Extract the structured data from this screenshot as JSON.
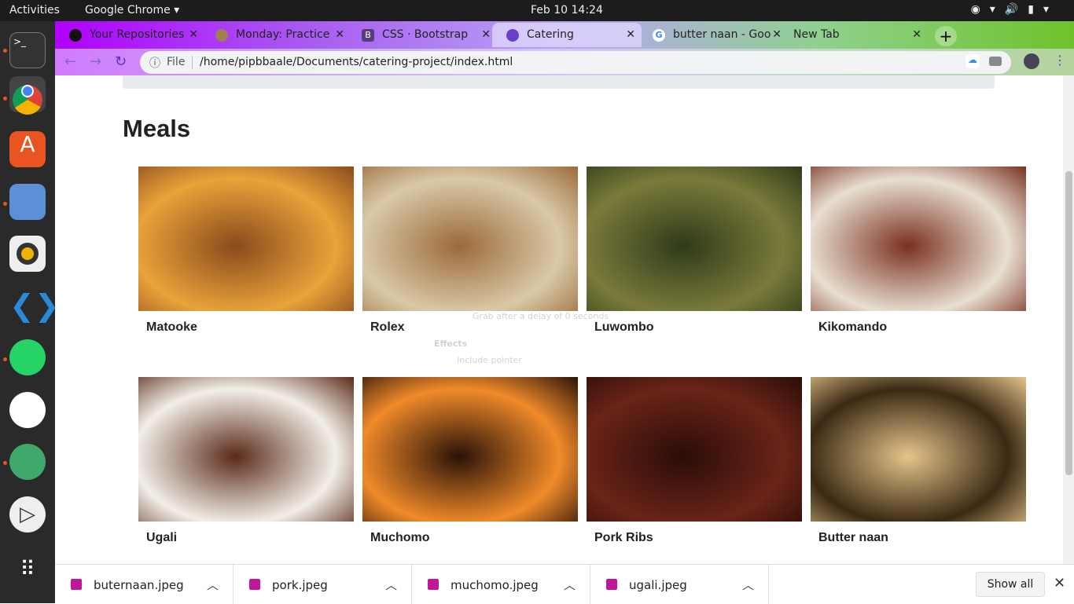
{
  "system": {
    "activities": "Activities",
    "app": "Google Chrome ▾",
    "clock": "Feb 10  14:24"
  },
  "tabs": [
    {
      "label": "Your Repositories",
      "icon": "github-icon"
    },
    {
      "label": "Monday: Practice",
      "icon": "page-icon"
    },
    {
      "label": "CSS · Bootstrap",
      "icon": "bootstrap-icon"
    },
    {
      "label": "Catering",
      "icon": "globe-icon",
      "active": true
    },
    {
      "label": "butter naan - Goo",
      "icon": "google-icon"
    },
    {
      "label": "New Tab",
      "icon": ""
    }
  ],
  "omnibox": {
    "scheme": "File",
    "url": "/home/pipbbaale/Documents/catering-project/index.html"
  },
  "page": {
    "title": "Meals"
  },
  "meals": [
    {
      "name": "Matooke",
      "colors": [
        "#e9a33a",
        "#8a4a1c"
      ]
    },
    {
      "name": "Rolex",
      "colors": [
        "#d9c9a8",
        "#9b6a3a"
      ]
    },
    {
      "name": "Luwombo",
      "colors": [
        "#7a7b3a",
        "#2f3a1a"
      ]
    },
    {
      "name": "Kikomando",
      "colors": [
        "#e8dfd0",
        "#7a3020"
      ]
    },
    {
      "name": "Ugali",
      "colors": [
        "#f2efe8",
        "#5a2a18"
      ]
    },
    {
      "name": "Muchomo",
      "colors": [
        "#f08a2a",
        "#2a1208"
      ]
    },
    {
      "name": "Pork Ribs",
      "colors": [
        "#6a2418",
        "#2a0d08"
      ]
    },
    {
      "name": "Butter naan",
      "colors": [
        "#3a2a14",
        "#e6c48a"
      ]
    }
  ],
  "ghost": {
    "line1": "Grab after a delay of  0  seconds",
    "line2": "Effects",
    "line3": "Include pointer"
  },
  "downloads": [
    {
      "name": "buternaan.jpeg"
    },
    {
      "name": "pork.jpeg"
    },
    {
      "name": "muchomo.jpeg"
    },
    {
      "name": "ugali.jpeg"
    }
  ],
  "download_bar": {
    "show_all": "Show all"
  }
}
